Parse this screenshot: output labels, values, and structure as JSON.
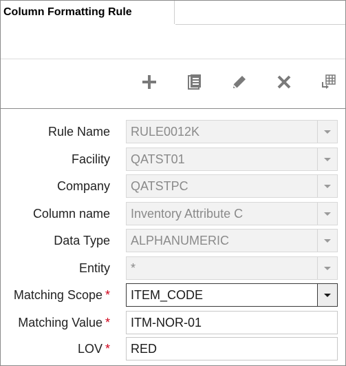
{
  "window": {
    "title": "Column Formatting Rule"
  },
  "toolbar": {
    "add_icon": "plus-icon",
    "copy_icon": "copy-icon",
    "edit_icon": "pencil-icon",
    "delete_icon": "x-icon",
    "export_icon": "table-export-icon"
  },
  "colors": {
    "required": "#d0021b",
    "readonly_bg": "#f2f2f2",
    "readonly_text": "#8a8a8a",
    "icon": "#7a7a7a"
  },
  "form": {
    "fields": [
      {
        "label": "Rule Name",
        "value": "RULE0012K",
        "required": false,
        "readonly": true,
        "dropdown": true
      },
      {
        "label": "Facility",
        "value": "QATST01",
        "required": false,
        "readonly": true,
        "dropdown": true
      },
      {
        "label": "Company",
        "value": "QATSTPC",
        "required": false,
        "readonly": true,
        "dropdown": true
      },
      {
        "label": "Column name",
        "value": "Inventory Attribute C",
        "required": false,
        "readonly": true,
        "dropdown": true
      },
      {
        "label": "Data Type",
        "value": "ALPHANUMERIC",
        "required": false,
        "readonly": true,
        "dropdown": true
      },
      {
        "label": "Entity",
        "value": "*",
        "required": false,
        "readonly": true,
        "dropdown": true
      },
      {
        "label": "Matching Scope",
        "value": "ITEM_CODE",
        "required": true,
        "readonly": false,
        "dropdown": true
      },
      {
        "label": "Matching Value",
        "value": "ITM-NOR-01",
        "required": true,
        "readonly": false,
        "dropdown": false
      },
      {
        "label": "LOV",
        "value": "RED",
        "required": true,
        "readonly": false,
        "dropdown": false
      }
    ],
    "required_mark": "*"
  }
}
